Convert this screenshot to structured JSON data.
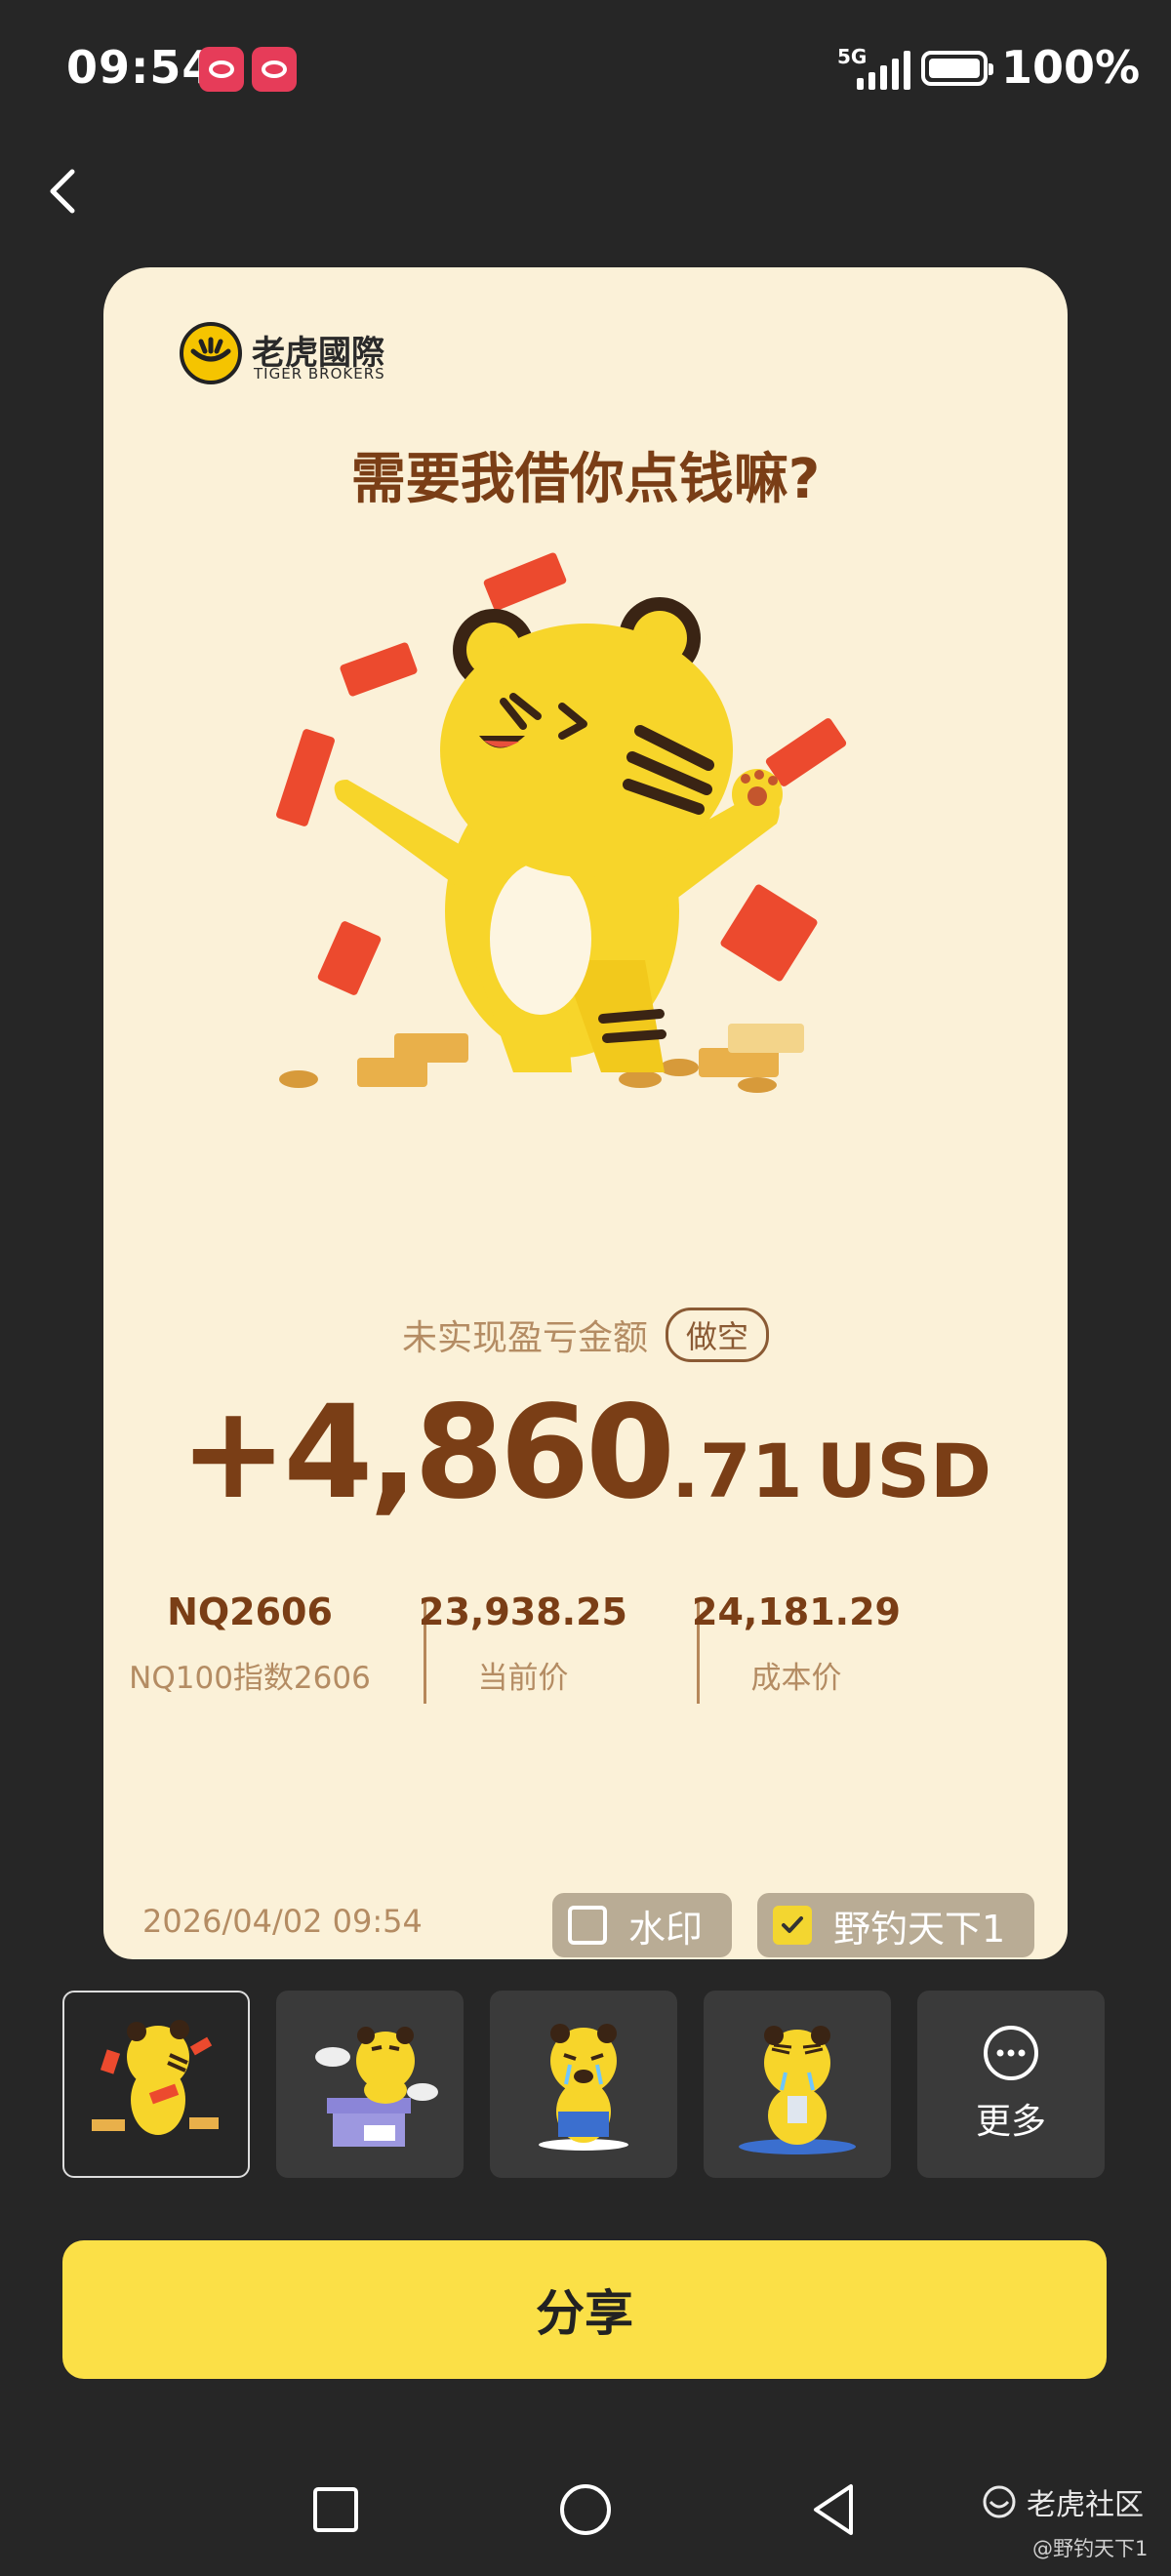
{
  "status_bar": {
    "time": "09:54",
    "network": "5G",
    "battery": "100%"
  },
  "card": {
    "brand": {
      "name_cn": "老虎國際",
      "name_en": "TIGER BROKERS"
    },
    "headline": "需要我借你点钱嘛?",
    "pnl": {
      "label": "未实现盈亏金额",
      "position_badge": "做空",
      "amount_int": "+4,860",
      "amount_dec": ".71",
      "currency": "USD"
    },
    "stats": [
      {
        "value": "NQ2606",
        "label": "NQ100指数2606"
      },
      {
        "value": "23,938.25",
        "label": "当前价"
      },
      {
        "value": "24,181.29",
        "label": "成本价"
      }
    ],
    "timestamp": "2026/04/02 09:54",
    "watermark_toggle": {
      "label": "水印",
      "checked": false
    },
    "nickname_toggle": {
      "label": "野钓天下1",
      "checked": true
    }
  },
  "templates": {
    "selected_index": 0,
    "more_label": "更多"
  },
  "share_button": "分享",
  "community_watermark": {
    "name": "老虎社区",
    "user": "@野钓天下1"
  },
  "colors": {
    "card_bg": "#fbf1d8",
    "primary_brown": "#7a3e16",
    "muted_brown": "#b48c63",
    "share_yellow": "#fbe047",
    "page_bg": "#262626"
  }
}
